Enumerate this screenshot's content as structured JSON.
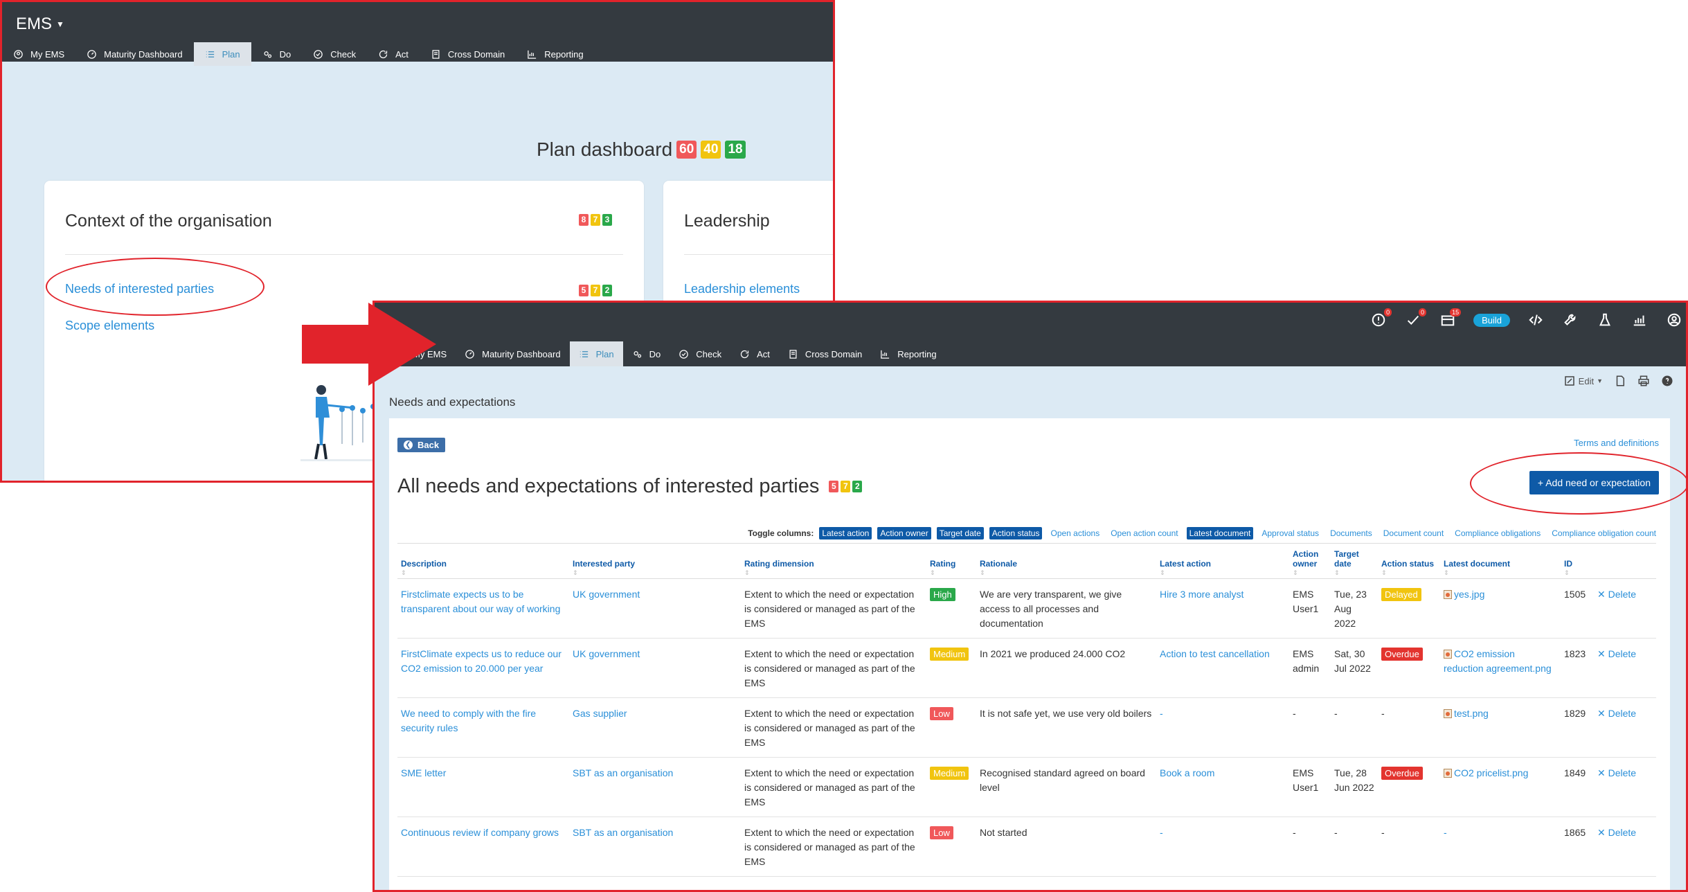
{
  "panel_a": {
    "app_name": "EMS",
    "nav": [
      {
        "label": "My EMS",
        "icon": "user-circle-icon"
      },
      {
        "label": "Maturity Dashboard",
        "icon": "dashboard-icon"
      },
      {
        "label": "Plan",
        "icon": "list-icon",
        "active": true
      },
      {
        "label": "Do",
        "icon": "cogs-icon"
      },
      {
        "label": "Check",
        "icon": "check-circle-icon"
      },
      {
        "label": "Act",
        "icon": "redo-icon"
      },
      {
        "label": "Cross Domain",
        "icon": "book-icon"
      },
      {
        "label": "Reporting",
        "icon": "chart-icon"
      }
    ],
    "dashboard_title": "Plan dashboard",
    "dashboard_counts": [
      "60",
      "40",
      "18"
    ],
    "card_context": {
      "title": "Context of the organisation",
      "counts": [
        "8",
        "7",
        "3"
      ],
      "links": [
        {
          "label": "Needs of interested parties",
          "counts": [
            "5",
            "7",
            "2"
          ]
        },
        {
          "label": "Scope elements"
        }
      ]
    },
    "card_leadership": {
      "title": "Leadership",
      "links": [
        {
          "label": "Leadership elements"
        }
      ]
    }
  },
  "panel_b": {
    "header_icons": [
      {
        "icon": "user-alert-icon",
        "badge": "0"
      },
      {
        "icon": "checkmark-icon",
        "badge": "0"
      },
      {
        "icon": "inbox-icon",
        "badge": "15"
      },
      {
        "icon": "build-toggle",
        "label": "Build"
      },
      {
        "icon": "code-icon"
      },
      {
        "icon": "wrench-icon"
      },
      {
        "icon": "flask-icon"
      },
      {
        "icon": "stats-icon"
      },
      {
        "icon": "account-icon"
      }
    ],
    "build_label": "Build",
    "nav": [
      {
        "label": "My EMS"
      },
      {
        "label": "Maturity Dashboard"
      },
      {
        "label": "Plan",
        "active": true
      },
      {
        "label": "Do"
      },
      {
        "label": "Check"
      },
      {
        "label": "Act"
      },
      {
        "label": "Cross Domain"
      },
      {
        "label": "Reporting"
      }
    ],
    "edit_label": "Edit",
    "breadcrumb": "Needs and expectations",
    "back_label": "Back",
    "terms_label": "Terms and definitions",
    "title": "All needs and expectations of interested parties",
    "title_counts": [
      "5",
      "7",
      "2"
    ],
    "add_button": "+ Add need or expectation",
    "toggle_label": "Toggle columns:",
    "toggles": [
      {
        "label": "Latest action",
        "on": true
      },
      {
        "label": "Action owner",
        "on": true
      },
      {
        "label": "Target date",
        "on": true
      },
      {
        "label": "Action status",
        "on": true
      },
      {
        "label": "Open actions",
        "on": false
      },
      {
        "label": "Open action count",
        "on": false
      },
      {
        "label": "Latest document",
        "on": true
      },
      {
        "label": "Approval status",
        "on": false
      },
      {
        "label": "Documents",
        "on": false
      },
      {
        "label": "Document count",
        "on": false
      },
      {
        "label": "Compliance obligations",
        "on": false
      },
      {
        "label": "Compliance obligation count",
        "on": false
      }
    ],
    "columns": [
      "Description",
      "Interested party",
      "Rating dimension",
      "Rating",
      "Rationale",
      "Latest action",
      "Action owner",
      "Target date",
      "Action status",
      "Latest document",
      "ID",
      ""
    ],
    "rows": [
      {
        "description": "Firstclimate expects us to be transparent about our way of working",
        "party": "UK government",
        "dimension": "Extent to which the need or expectation is considered or managed as part of the EMS",
        "rating": "High",
        "rationale": "We are very transparent, we give access to all processes and documentation",
        "latest_action": "Hire 3 more analyst",
        "owner": "EMS User1",
        "target_date": "Tue, 23 Aug 2022",
        "status": "Delayed",
        "document": "yes.jpg",
        "id": "1505",
        "delete": "✕ Delete"
      },
      {
        "description": "FirstClimate expects us to reduce our CO2 emission to 20.000 per year",
        "party": "UK government",
        "dimension": "Extent to which the need or expectation is considered or managed as part of the EMS",
        "rating": "Medium",
        "rationale": "In 2021 we produced 24.000 CO2",
        "latest_action": "Action to test cancellation",
        "owner": "EMS admin",
        "target_date": "Sat, 30 Jul 2022",
        "status": "Overdue",
        "document": "CO2 emission reduction agreement.png",
        "id": "1823",
        "delete": "✕ Delete"
      },
      {
        "description": "We need to comply with the fire security rules",
        "party": "Gas supplier",
        "dimension": "Extent to which the need or expectation is considered or managed as part of the EMS",
        "rating": "Low",
        "rationale": "It is not safe yet, we use very old boilers",
        "latest_action": "-",
        "owner": "-",
        "target_date": "-",
        "status": "-",
        "document": "test.png",
        "id": "1829",
        "delete": "✕ Delete"
      },
      {
        "description": "SME letter",
        "party": "SBT as an organisation",
        "dimension": "Extent to which the need or expectation is considered or managed as part of the EMS",
        "rating": "Medium",
        "rationale": "Recognised standard agreed on board level",
        "latest_action": "Book a room",
        "owner": "EMS User1",
        "target_date": "Tue, 28 Jun 2022",
        "status": "Overdue",
        "document": "CO2 pricelist.png",
        "id": "1849",
        "delete": "✕ Delete"
      },
      {
        "description": "Continuous review if company grows",
        "party": "SBT as an organisation",
        "dimension": "Extent to which the need or expectation is considered or managed as part of the EMS",
        "rating": "Low",
        "rationale": "Not started",
        "latest_action": "-",
        "owner": "-",
        "target_date": "-",
        "status": "-",
        "document": "-",
        "id": "1865",
        "delete": "✕ Delete"
      }
    ]
  },
  "colors": {
    "annotation_red": "#e1232b",
    "nav_dark": "#343a40",
    "page_bg": "#dceaf4",
    "link_blue": "#2a8fd8",
    "primary_blue": "#0e5aa7",
    "red_count": "#f0585a",
    "yellow_count": "#f1c40f",
    "green_count": "#2aa84a"
  }
}
